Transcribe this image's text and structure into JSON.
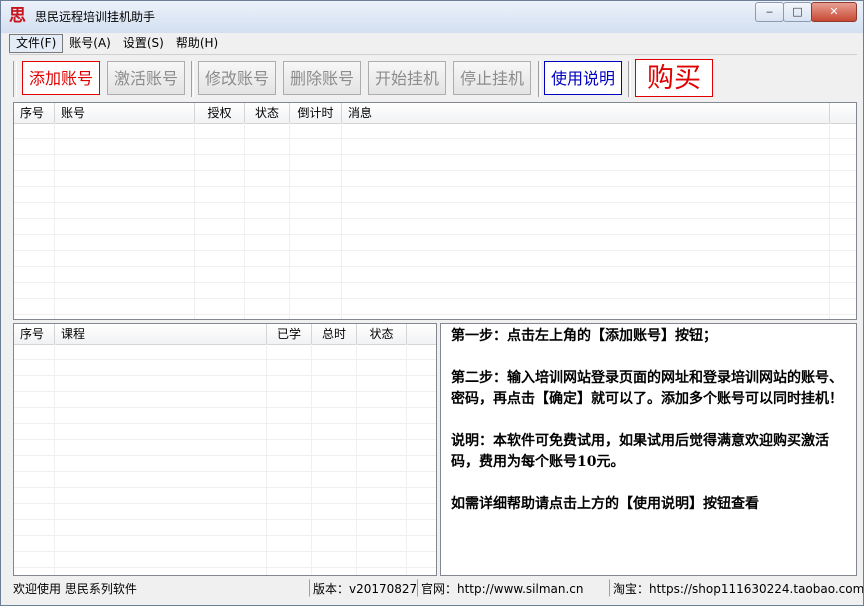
{
  "window": {
    "icon_glyph": "思",
    "title": "思民远程培训挂机助手",
    "minimize": "‒",
    "maximize": "□",
    "close": "✕"
  },
  "menu": [
    "文件(F)",
    "账号(A)",
    "设置(S)",
    "帮助(H)"
  ],
  "toolbar": {
    "add": "添加账号",
    "activate": "激活账号",
    "edit": "修改账号",
    "delete": "删除账号",
    "start": "开始挂机",
    "stop": "停止挂机",
    "help": "使用说明",
    "buy": "购买"
  },
  "accounts_table": {
    "columns": [
      "序号",
      "账号",
      "授权",
      "状态",
      "倒计时",
      "消息"
    ],
    "rows": []
  },
  "courses_table": {
    "columns": [
      "序号",
      "课程",
      "已学",
      "总时",
      "状态"
    ],
    "rows": []
  },
  "instructions": [
    "第一步：点击左上角的【添加账号】按钮；",
    "第二步：输入培训网站登录页面的网址和登录培训网站的账号、密码，再点击【确定】就可以了。添加多个账号可以同时挂机！",
    "说明：本软件可免费试用，如果试用后觉得满意欢迎购买激活码，费用为每个账号10元。",
    "如需详细帮助请点击上方的【使用说明】按钮查看"
  ],
  "statusbar": {
    "welcome": "欢迎使用 思民系列软件",
    "version": "版本：v20170827",
    "website": "官网：http://www.silman.cn",
    "taobao": "淘宝：https://shop111630224.taobao.com"
  },
  "colors": {
    "accent_red": "#e00000",
    "accent_blue": "#0000c0",
    "disabled_text": "#8c8c8c"
  }
}
